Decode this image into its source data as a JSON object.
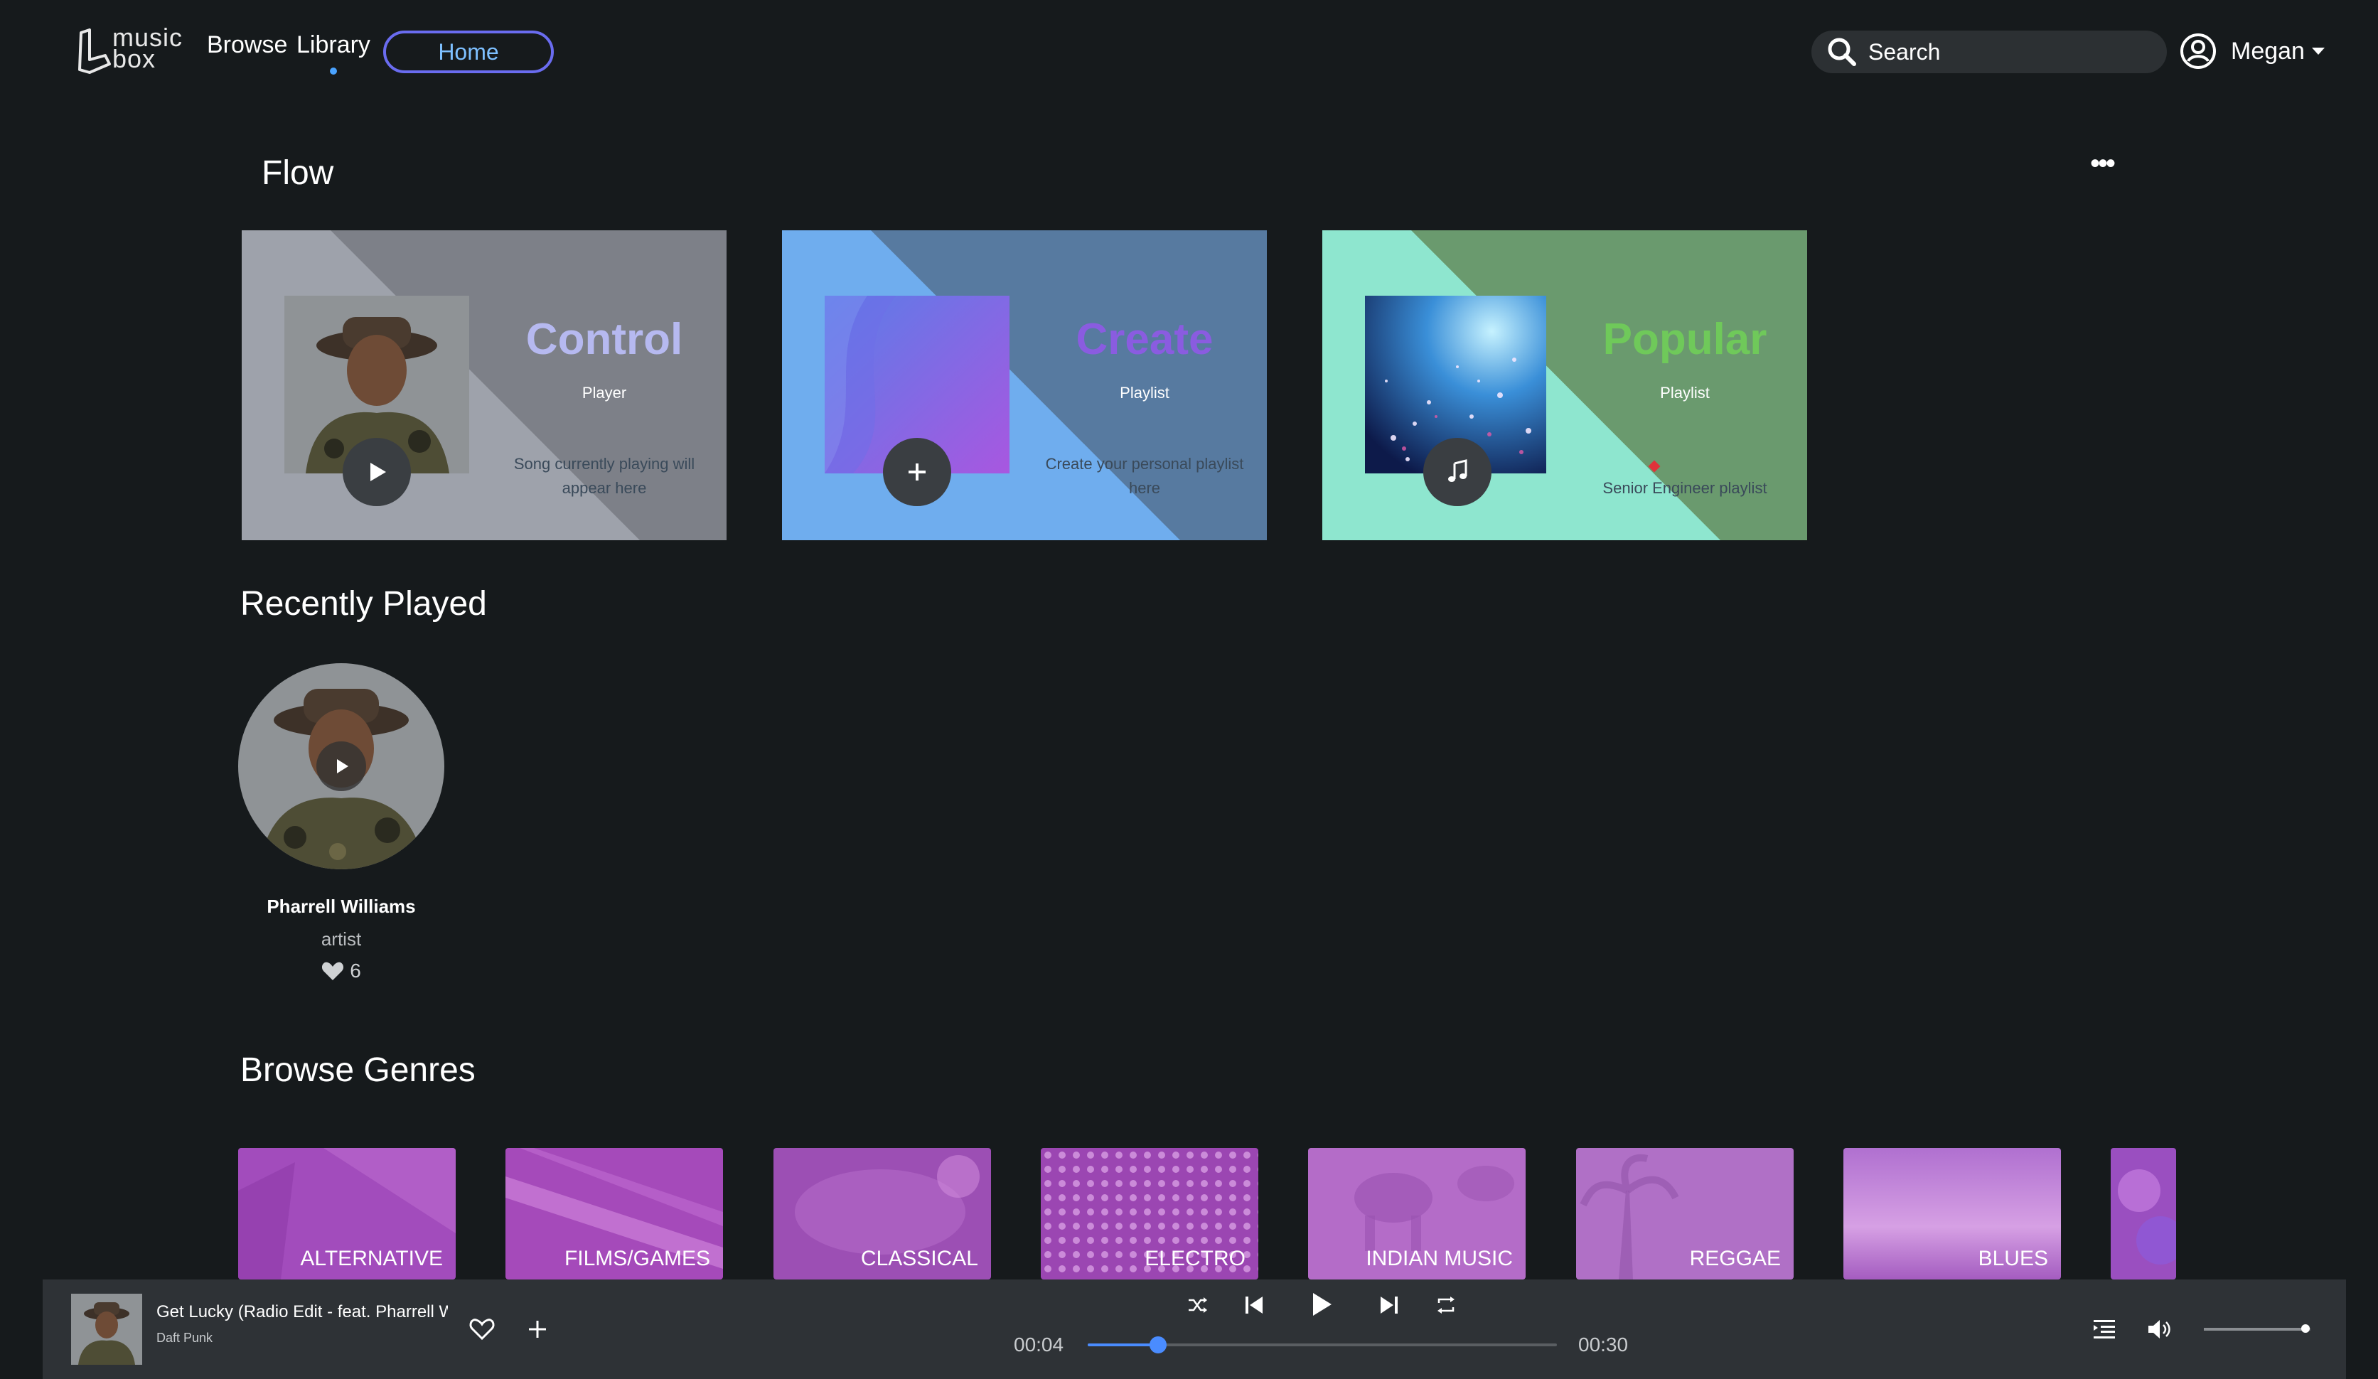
{
  "header": {
    "logo_line1": "music",
    "logo_line2": "box",
    "nav": {
      "browse": "Browse",
      "library": "Library",
      "home": "Home"
    },
    "search_placeholder": "Search",
    "user_name": "Megan"
  },
  "flow": {
    "title": "Flow",
    "more_label": "•••",
    "cards": [
      {
        "title": "Control",
        "subtitle": "Player",
        "description": "Song currently playing will appear here",
        "title_color": "#b6b9f0",
        "bg_main": "#9ea2ab",
        "bg_tri": "#7d8088",
        "icon": "play-icon"
      },
      {
        "title": "Create",
        "subtitle": "Playlist",
        "description": "Create your personal playlist here",
        "title_color": "#8a5ce0",
        "bg_main": "#6fadee",
        "bg_tri": "#577aa0",
        "icon": "plus-icon"
      },
      {
        "title": "Popular",
        "subtitle": "Playlist",
        "description": "Senior Engineer playlist",
        "title_color": "#6fc95a",
        "bg_main": "#8ee6cf",
        "bg_tri": "#6a9a6e",
        "icon": "music-note-icon"
      }
    ]
  },
  "recently_played": {
    "title": "Recently Played",
    "items": [
      {
        "name": "Pharrell Williams",
        "type": "artist",
        "likes": "6"
      }
    ]
  },
  "genres": {
    "title": "Browse Genres",
    "items": [
      {
        "label": "ALTERNATIVE"
      },
      {
        "label": "FILMS/GAMES"
      },
      {
        "label": "CLASSICAL"
      },
      {
        "label": "ELECTRO"
      },
      {
        "label": "INDIAN MUSIC"
      },
      {
        "label": "REGGAE"
      },
      {
        "label": "BLUES"
      },
      {
        "label": ""
      }
    ]
  },
  "player": {
    "track_title": "Get Lucky (Radio Edit - feat. Pharrell Williams)",
    "artist": "Daft Punk",
    "elapsed": "00:04",
    "duration": "00:30",
    "progress_fraction": 0.15,
    "volume_fraction": 0.95
  },
  "colors": {
    "background": "#161a1c",
    "accent_blue": "#4a8cff",
    "player_bar": "#2e3236"
  }
}
